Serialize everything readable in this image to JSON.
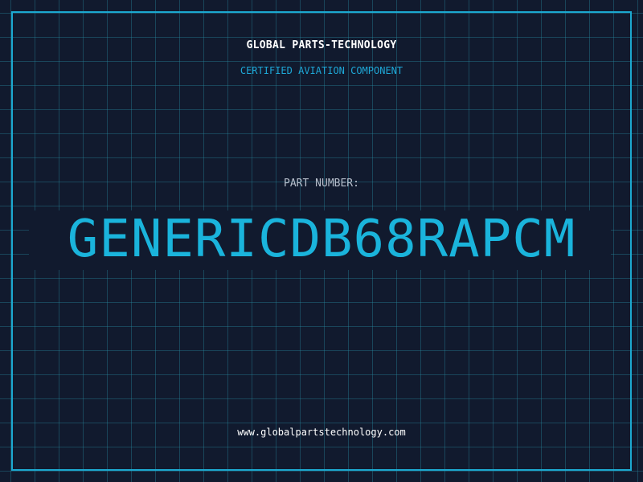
{
  "header": {
    "company_name": "GLOBAL PARTS-TECHNOLOGY",
    "tagline": "CERTIFIED AVIATION COMPONENT"
  },
  "part": {
    "label": "PART NUMBER:",
    "number": "GENERICDB68RAPCM"
  },
  "footer": {
    "url": "www.globalpartstechnology.com"
  },
  "colors": {
    "background": "#111a2e",
    "grid": "#268ca0",
    "frame": "#1ca8d0",
    "accent": "#1ab4dc",
    "label": "#b7bfcc",
    "text": "#ffffff"
  }
}
